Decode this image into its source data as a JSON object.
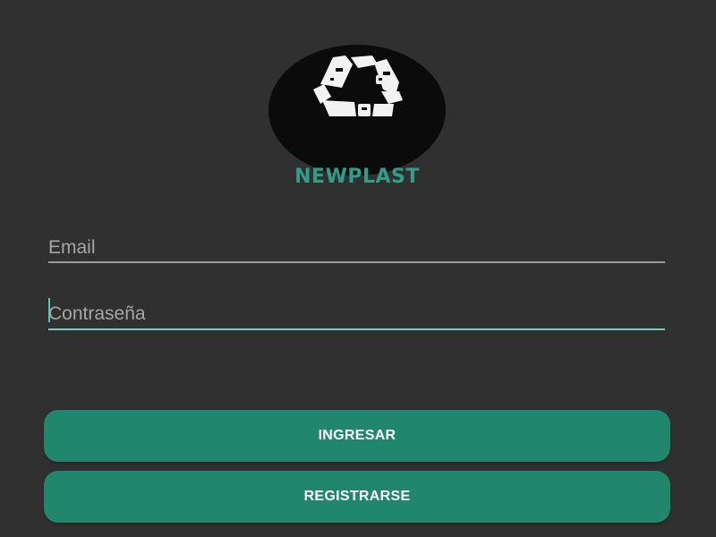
{
  "logo": {
    "text": "NEWPLAST",
    "icon": "recycle-bottles-icon"
  },
  "form": {
    "email_placeholder": "Email",
    "email_value": "",
    "password_placeholder": "Contraseña",
    "password_value": ""
  },
  "buttons": {
    "login_label": "INGRESAR",
    "register_label": "REGISTRARSE"
  },
  "colors": {
    "background": "#303030",
    "accent": "#20866c",
    "logo_text": "#2e9f86",
    "focus_underline": "#6fd0c0"
  }
}
